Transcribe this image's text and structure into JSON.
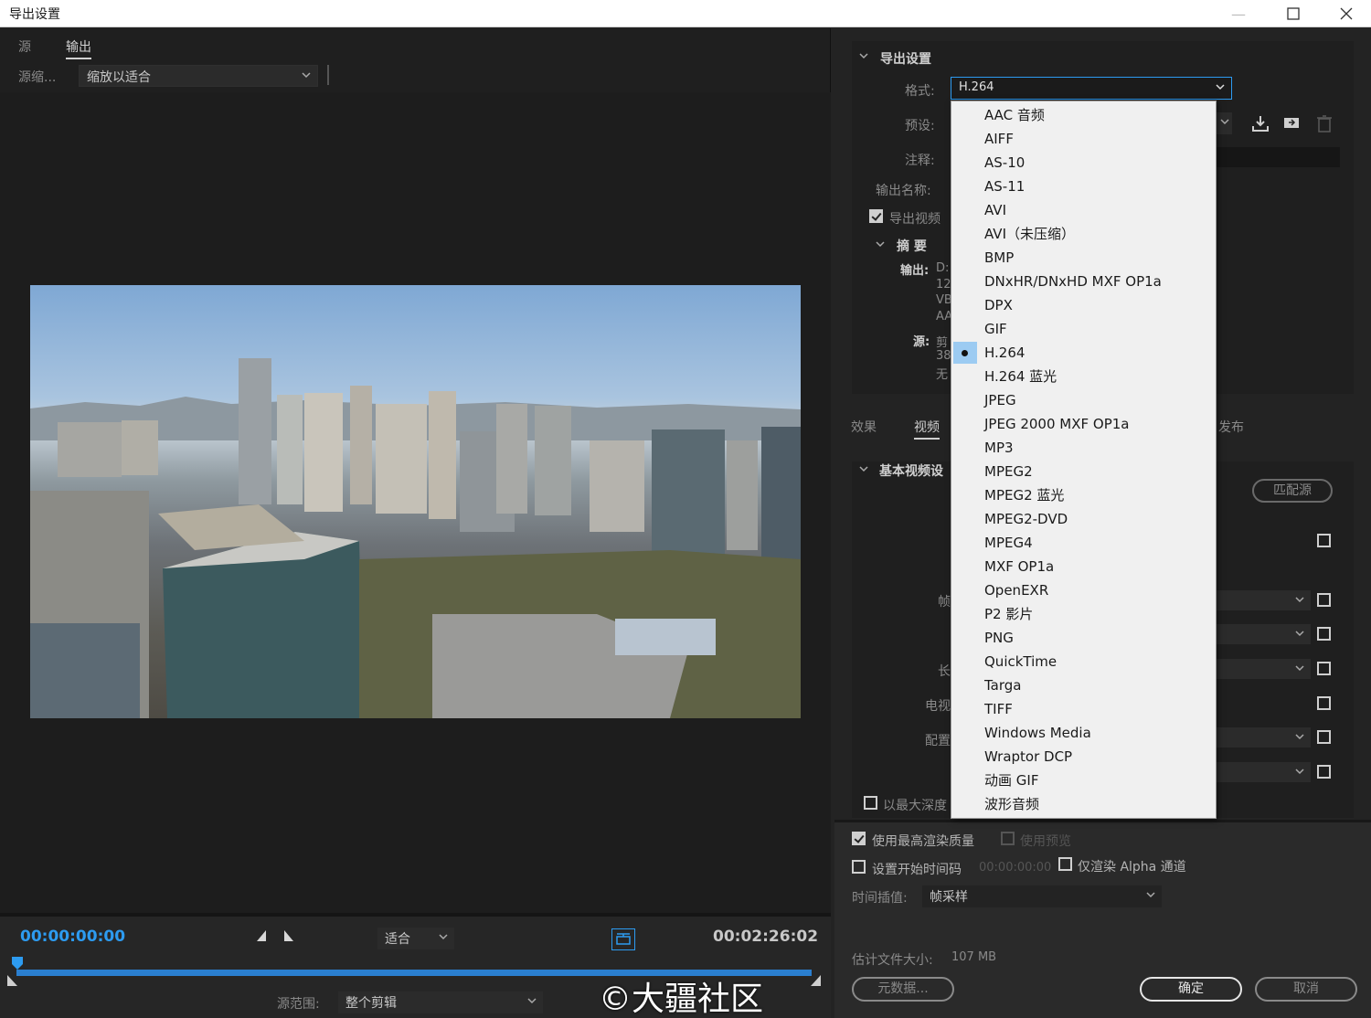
{
  "window": {
    "title": "导出设置"
  },
  "left": {
    "tabs": [
      {
        "label": "源"
      },
      {
        "label": "输出"
      }
    ],
    "source_scale_label": "源缩...",
    "source_scale_value": "缩放以适合",
    "timecode_start": "00:00:00:00",
    "timecode_end": "00:02:26:02",
    "zoom_value": "适合",
    "source_range_label": "源范围:",
    "source_range_value": "整个剪辑"
  },
  "watermark": "©大疆社区",
  "right": {
    "export_settings_heading": "导出设置",
    "format_label": "格式:",
    "format_value": "H.264",
    "preset_label": "预设:",
    "comment_label": "注释:",
    "output_name_label": "输出名称:",
    "export_video_label": "导出视频",
    "summary_heading": "摘 要",
    "summary_output_label": "输出:",
    "summary_output_lines": [
      "D:",
      "12",
      "VB",
      "AA"
    ],
    "summary_source_label": "源:",
    "summary_source_lines": [
      "剪",
      "38",
      "无"
    ],
    "tabs": [
      {
        "label": "效果"
      },
      {
        "label": "视频"
      },
      {
        "label": "发布"
      }
    ],
    "basic_video_heading": "基本视频设",
    "match_source_label": "匹配源",
    "row_labels": [
      "帧",
      "长",
      "电视",
      "配置"
    ],
    "max_depth_label": "以最大深度",
    "use_max_render_label": "使用最高渲染质量",
    "use_preview_label": "使用预览",
    "set_start_tc_label": "设置开始时间码",
    "start_tc_value": "00:00:00:00",
    "render_alpha_label": "仅渲染 Alpha 通道",
    "time_interp_label": "时间插值:",
    "time_interp_value": "帧采样",
    "est_size_label": "估计文件大小:",
    "est_size_value": "107 MB",
    "metadata_button": "元数据...",
    "ok_button": "确定",
    "cancel_button": "取消"
  },
  "format_dropdown": {
    "selected": "H.264",
    "options": [
      "AAC 音频",
      "AIFF",
      "AS-10",
      "AS-11",
      "AVI",
      "AVI（未压缩）",
      "BMP",
      "DNxHR/DNxHD MXF OP1a",
      "DPX",
      "GIF",
      "H.264",
      "H.264 蓝光",
      "JPEG",
      "JPEG 2000 MXF OP1a",
      "MP3",
      "MPEG2",
      "MPEG2 蓝光",
      "MPEG2-DVD",
      "MPEG4",
      "MXF OP1a",
      "OpenEXR",
      "P2 影片",
      "PNG",
      "QuickTime",
      "Targa",
      "TIFF",
      "Windows Media",
      "Wraptor DCP",
      "动画 GIF",
      "波形音频"
    ]
  },
  "colors": {
    "accent": "#2d9bf0",
    "selected_item": "#9ccbf2",
    "panel": "#1f1f1f"
  }
}
